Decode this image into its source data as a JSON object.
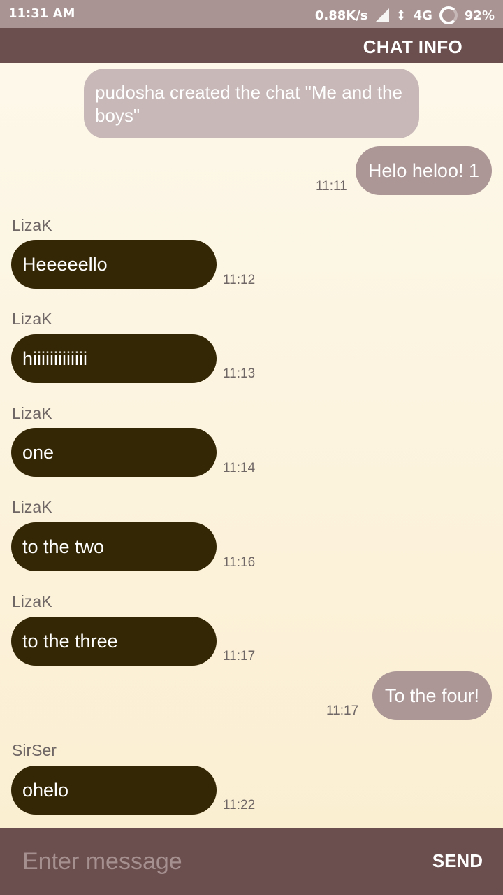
{
  "status_bar": {
    "time": "11:31 AM",
    "network_speed": "0.88K/s",
    "network_type": "4G",
    "battery": "92%"
  },
  "app_bar": {
    "chat_info_label": "CHAT INFO"
  },
  "chat": {
    "system_message": "pudosha created the chat \"Me and the boys\"",
    "messages": [
      {
        "direction": "out",
        "text": "Helo heloo! 1",
        "time": "11:11"
      },
      {
        "direction": "in",
        "sender": "LizaK",
        "text": "Heeeeello",
        "time": "11:12"
      },
      {
        "direction": "in",
        "sender": "LizaK",
        "text": "hiiiiiiiiiiiii",
        "time": "11:13"
      },
      {
        "direction": "in",
        "sender": "LizaK",
        "text": "one",
        "time": "11:14"
      },
      {
        "direction": "in",
        "sender": "LizaK",
        "text": "to the two",
        "time": "11:16"
      },
      {
        "direction": "in",
        "sender": "LizaK",
        "text": "to the three",
        "time": "11:17"
      },
      {
        "direction": "out",
        "text": "To the four!",
        "time": "11:17"
      },
      {
        "direction": "in",
        "sender": "SirSer",
        "text": "ohelo",
        "time": "11:22"
      }
    ]
  },
  "composer": {
    "placeholder": "Enter message",
    "value": "",
    "send_label": "SEND"
  },
  "colors": {
    "status_bar": "#a99393",
    "app_bar": "#6b4e4e",
    "incoming_bubble": "#342705",
    "outgoing_bubble": "#ac9696",
    "system_bubble": "#c8b8b8"
  }
}
